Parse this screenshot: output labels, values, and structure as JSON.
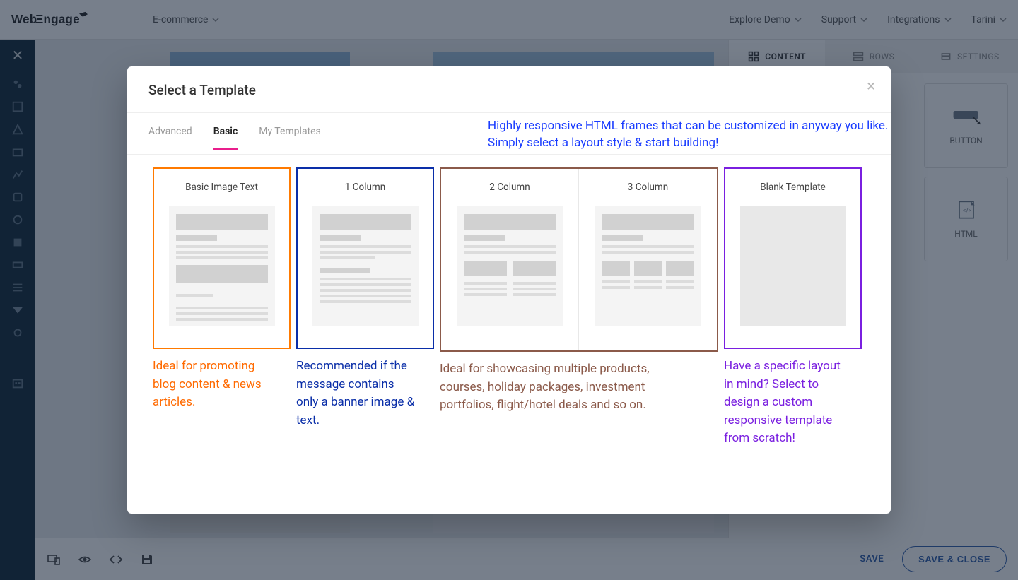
{
  "header": {
    "brand": "E-commerce",
    "links": [
      "Explore Demo",
      "Support",
      "Integrations",
      "Tarini"
    ]
  },
  "rpanel": {
    "tabs": {
      "content": "CONTENT",
      "rows": "ROWS",
      "settings": "SETTINGS"
    },
    "tiles": {
      "button": "BUTTON",
      "html": "HTML"
    }
  },
  "footer": {
    "save": "SAVE",
    "save_close": "SAVE & CLOSE"
  },
  "modal": {
    "title": "Select a Template",
    "tabs": {
      "advanced": "Advanced",
      "basic": "Basic",
      "my": "My Templates"
    },
    "intro_l1": "Highly responsive HTML frames that can be customized in anyway you like.",
    "intro_l2": "Simply select a layout style & start building!",
    "cards": {
      "bit": {
        "title": "Basic Image Text",
        "desc": "Ideal for promoting blog content & news articles."
      },
      "c1": {
        "title": "1 Column",
        "desc": "Recommended if the message contains only a banner image & text."
      },
      "c2": {
        "title": "2 Column"
      },
      "c3": {
        "title": "3 Column"
      },
      "cols_desc": "Ideal for showcasing multiple products, courses, holiday packages, investment portfolios, flight/hotel deals and so on.",
      "blank": {
        "title": "Blank Template",
        "desc": "Have a specific layout in mind? Select to design a custom responsive template from scratch!"
      }
    }
  }
}
